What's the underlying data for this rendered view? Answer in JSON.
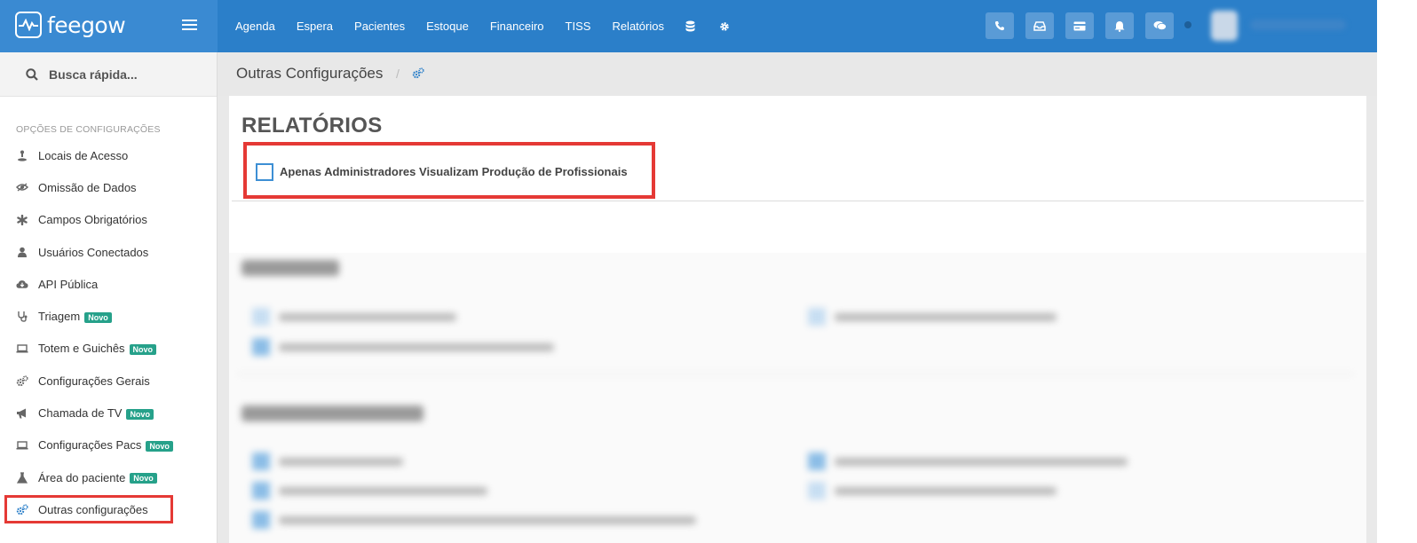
{
  "app": {
    "logo_text": "feegow"
  },
  "topnav": {
    "items": [
      "Agenda",
      "Espera",
      "Pacientes",
      "Estoque",
      "Financeiro",
      "TISS",
      "Relatórios"
    ],
    "icons": [
      "database-icon",
      "gear-icon"
    ],
    "action_buttons": [
      "phone-icon",
      "inbox-icon",
      "card-icon",
      "bell-icon",
      "chat-icon"
    ]
  },
  "sidebar": {
    "search_label": "Busca rápida...",
    "heading": "OPÇÕES DE CONFIGURAÇÕES",
    "items": [
      {
        "label": "Locais de Acesso",
        "icon": "location-pin-icon",
        "badge": ""
      },
      {
        "label": "Omissão de Dados",
        "icon": "eye-slash-icon",
        "badge": ""
      },
      {
        "label": "Campos Obrigatórios",
        "icon": "asterisk-icon",
        "badge": ""
      },
      {
        "label": "Usuários Conectados",
        "icon": "user-icon",
        "badge": ""
      },
      {
        "label": "API Pública",
        "icon": "cloud-download-icon",
        "badge": ""
      },
      {
        "label": "Triagem",
        "icon": "stethoscope-icon",
        "badge": "Novo"
      },
      {
        "label": "Totem e Guichês",
        "icon": "laptop-icon",
        "badge": "Novo"
      },
      {
        "label": "Configurações Gerais",
        "icon": "cogs-icon",
        "badge": ""
      },
      {
        "label": "Chamada de TV",
        "icon": "bullhorn-icon",
        "badge": "Novo"
      },
      {
        "label": "Configurações Pacs",
        "icon": "laptop-icon",
        "badge": "Novo"
      },
      {
        "label": "Área do paciente",
        "icon": "flask-icon",
        "badge": "Novo"
      },
      {
        "label": "Outras configurações",
        "icon": "cogs-icon",
        "badge": ""
      }
    ]
  },
  "header": {
    "breadcrumb": "Outras Configurações",
    "separator": "/"
  },
  "panel": {
    "title": "RELATÓRIOS",
    "option_label": "Apenas Administradores Visualizam Produção de Profissionais",
    "checked": false
  },
  "colors": {
    "topbar": "#2b7fc9",
    "highlight": "#e53935",
    "badge": "#26a18a"
  }
}
